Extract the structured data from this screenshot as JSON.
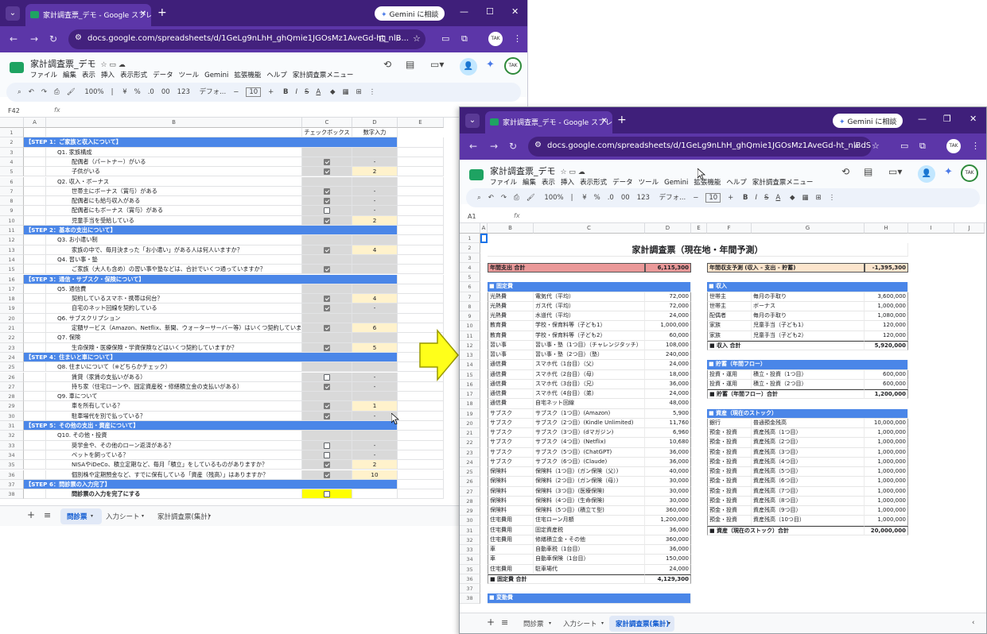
{
  "browser": {
    "tab_title": "家計調査票_デモ - Google スプレ",
    "tab_title_short": "家計調査票_デモ - Google スプレッ",
    "gemini_button": "Gemini に相談",
    "url_short": "docs.google.com/spreadsheets/d/1GeLg9nLhH_ghQmie1JGOsMz1AveGd-ht_nlB...",
    "url_long": "docs.google.com/spreadsheets/d/1GeLg9nLhH_ghQmie1JGOsMz1AveGd-ht_nlBdSvnx...",
    "avatar_text": "TAK"
  },
  "doc": {
    "title": "家計調査票_デモ",
    "menus": [
      "ファイル",
      "編集",
      "表示",
      "挿入",
      "表示形式",
      "データ",
      "ツール",
      "Gemini",
      "拡張機能",
      "ヘルプ",
      "家計調査票メニュー"
    ],
    "toolbar": [
      "100%",
      "¥",
      "%",
      ".0",
      "00",
      "123",
      "デフォ...",
      "10",
      "B",
      "I",
      "S",
      "A"
    ]
  },
  "left": {
    "cell_ref": "F42",
    "columns": [
      "A",
      "B",
      "C",
      "D",
      "E"
    ],
    "header_c": "チェックボックス",
    "header_d": "数字入力",
    "rows": [
      {
        "n": "2",
        "type": "step",
        "text": "【STEP 1：ご家族と収入について】"
      },
      {
        "n": "3",
        "type": "q",
        "text": "Q1. 家族構成"
      },
      {
        "n": "4",
        "type": "item",
        "text": "配偶者（パートナー）がいる",
        "cb": true,
        "d": "-"
      },
      {
        "n": "5",
        "type": "item",
        "text": "子供がいる",
        "cb": true,
        "d": "2",
        "y": true
      },
      {
        "n": "6",
        "type": "q",
        "text": "Q2. 収入・ボーナス"
      },
      {
        "n": "7",
        "type": "item",
        "text": "世帯主にボーナス（賞与）がある",
        "cb": true,
        "d": "-"
      },
      {
        "n": "8",
        "type": "item",
        "text": "配偶者にも給与収入がある",
        "cb": true,
        "d": "-"
      },
      {
        "n": "9",
        "type": "item",
        "text": "配偶者にもボーナス（賞与）がある",
        "cb": false,
        "d": "-"
      },
      {
        "n": "10",
        "type": "item",
        "text": "児童手当を受給している",
        "cb": true,
        "d": "2",
        "y": true
      },
      {
        "n": "11",
        "type": "step",
        "text": "【STEP 2：基本の支出について】"
      },
      {
        "n": "12",
        "type": "q",
        "text": "Q3. お小遣い制"
      },
      {
        "n": "13",
        "type": "item",
        "text": "家族の中で、毎月決まった「お小遣い」がある人は何人いますか？",
        "cb": true,
        "d": "4",
        "y": true
      },
      {
        "n": "14",
        "type": "q",
        "text": "Q4. 習い事・塾"
      },
      {
        "n": "15",
        "type": "item",
        "text": "ご家族（大人も含め）の習い事や塾などは、合計でいくつ通っていますか？",
        "cb": true,
        "d": ""
      },
      {
        "n": "16",
        "type": "step",
        "text": "【STEP 3：通信・サブスク・保険について】"
      },
      {
        "n": "17",
        "type": "q",
        "text": "Q5. 通信費"
      },
      {
        "n": "18",
        "type": "item",
        "text": "契約しているスマホ・携帯は何台？",
        "cb": true,
        "d": "4",
        "y": true
      },
      {
        "n": "19",
        "type": "item",
        "text": "自宅のネット回線を契約している",
        "cb": true,
        "d": "-"
      },
      {
        "n": "20",
        "type": "q",
        "text": "Q6. サブスクリプション"
      },
      {
        "n": "21",
        "type": "item",
        "text": "定額サービス（Amazon、Netflix、新聞、ウォーターサーバー等）はいくつ契約していますか？",
        "cb": true,
        "d": "6",
        "y": true
      },
      {
        "n": "22",
        "type": "q",
        "text": "Q7. 保険"
      },
      {
        "n": "23",
        "type": "item",
        "text": "生命保険・医療保険・学資保険などはいくつ契約していますか？",
        "cb": true,
        "d": "5",
        "y": true
      },
      {
        "n": "24",
        "type": "step",
        "text": "【STEP 4：住まいと車について】"
      },
      {
        "n": "25",
        "type": "q",
        "text": "Q8. 住まいについて（※どちらかチェック）"
      },
      {
        "n": "26",
        "type": "item",
        "text": "賃貸（家賃の支払いがある）",
        "cb": false,
        "d": "-"
      },
      {
        "n": "27",
        "type": "item",
        "text": "持ち家（住宅ローンや、固定資産税・修繕積立金の支払いがある）",
        "cb": true,
        "d": "-"
      },
      {
        "n": "28",
        "type": "q",
        "text": "Q9. 車について"
      },
      {
        "n": "29",
        "type": "item",
        "text": "車を所有している？",
        "cb": true,
        "d": "1",
        "y": true
      },
      {
        "n": "30",
        "type": "item",
        "text": "駐車場代を別で払っている？",
        "cb": true,
        "d": "-"
      },
      {
        "n": "31",
        "type": "step",
        "text": "【STEP 5：その他の支出・資産について】"
      },
      {
        "n": "32",
        "type": "q",
        "text": "Q10. その他・投資"
      },
      {
        "n": "33",
        "type": "item",
        "text": "奨学金や、その他のローン返済がある？",
        "cb": false,
        "d": "-"
      },
      {
        "n": "34",
        "type": "item",
        "text": "ペットを飼っている？",
        "cb": false,
        "d": "-"
      },
      {
        "n": "35",
        "type": "item",
        "text": "NISAやiDeCo、積立定期など、毎月「積立」をしているものがありますか？",
        "cb": true,
        "d": "2",
        "y": true
      },
      {
        "n": "36",
        "type": "item",
        "text": "個別株や定期預金など、すでに保有している「資産（残高）」はありますか？",
        "cb": true,
        "d": "10",
        "y": true
      },
      {
        "n": "37",
        "type": "step",
        "text": "【STEP 6：問診票の入力完了】"
      },
      {
        "n": "38",
        "type": "final",
        "text": "問診票の入力を完了にする",
        "cb": false,
        "d": ""
      }
    ],
    "sheets": [
      "問診票",
      "入力シート",
      "家計調査票(集計)"
    ],
    "active_sheet": 0
  },
  "right": {
    "cell_ref": "A1",
    "columns": [
      "A",
      "B",
      "C",
      "D",
      "E",
      "F",
      "G",
      "H",
      "I",
      "J"
    ],
    "title": "家計調査票（現在地・年間予測）",
    "annual_expense_label": "年間支出 合計",
    "annual_expense_value": "6,115,300",
    "annual_balance_label": "年間収支予測 (収入 - 支出 - 貯蓄)",
    "annual_balance_value": "-1,395,300",
    "fixed_header": "■ 固定費",
    "fixed": [
      [
        "光熱費",
        "電気代（平均）",
        "72,000"
      ],
      [
        "光熱費",
        "ガス代（平均）",
        "72,000"
      ],
      [
        "光熱費",
        "水道代（平均）",
        "24,000"
      ],
      [
        "教育費",
        "学校・保育料等（子ども1）",
        "1,000,000"
      ],
      [
        "教育費",
        "学校・保育料等（子ども2）",
        "60,000"
      ],
      [
        "習い事",
        "習い事・塾（1つ目）（チャレンジタッチ）",
        "108,000"
      ],
      [
        "習い事",
        "習い事・塾（2つ目）（塾）",
        "240,000"
      ],
      [
        "通信費",
        "スマホ代（1台目）（父）",
        "24,000"
      ],
      [
        "通信費",
        "スマホ代（2台目）（母）",
        "18,000"
      ],
      [
        "通信費",
        "スマホ代（3台目）（兄）",
        "36,000"
      ],
      [
        "通信費",
        "スマホ代（4台目）（弟）",
        "24,000"
      ],
      [
        "通信費",
        "自宅ネット回線",
        "48,000"
      ],
      [
        "サブスク",
        "サブスク（1つ目）(Amazon)",
        "5,900"
      ],
      [
        "サブスク",
        "サブスク（2つ目）(Kindle Unlimited)",
        "11,760"
      ],
      [
        "サブスク",
        "サブスク（3つ目）(dマガジン)",
        "6,960"
      ],
      [
        "サブスク",
        "サブスク（4つ目）(Netflix)",
        "10,680"
      ],
      [
        "サブスク",
        "サブスク（5つ目）(ChatGPT)",
        "36,000"
      ],
      [
        "サブスク",
        "サブスク（6つ目）(Claude)",
        "36,000"
      ],
      [
        "保険料",
        "保険料（1つ目）(ガン保険（父）)",
        "40,000"
      ],
      [
        "保険料",
        "保険料（2つ目）(ガン保険（母）)",
        "30,000"
      ],
      [
        "保険料",
        "保険料（3つ目）(医療保険)",
        "30,000"
      ],
      [
        "保険料",
        "保険料（4つ目）(生命保険)",
        "30,000"
      ],
      [
        "保険料",
        "保険料（5つ目）(積立て型)",
        "360,000"
      ],
      [
        "住宅費用",
        "住宅ローン月額",
        "1,200,000"
      ],
      [
        "住宅費用",
        "固定資産税",
        "36,000"
      ],
      [
        "住宅費用",
        "修繕積立金・その他",
        "360,000"
      ],
      [
        "車",
        "自動車税（1台目）",
        "36,000"
      ],
      [
        "車",
        "自動車保険（1台目）",
        "150,000"
      ],
      [
        "住宅費用",
        "駐車場代",
        "24,000"
      ]
    ],
    "fixed_total_label": "■ 固定費 合計",
    "fixed_total_value": "4,129,300",
    "variable_header": "■ 変動費",
    "income_header": "■ 収入",
    "income": [
      [
        "世帯主",
        "毎月の手取り",
        "3,600,000"
      ],
      [
        "世帯主",
        "ボーナス",
        "1,000,000"
      ],
      [
        "配偶者",
        "毎月の手取り",
        "1,080,000"
      ],
      [
        "家族",
        "児童手当（子ども1）",
        "120,000"
      ],
      [
        "家族",
        "児童手当（子ども2）",
        "120,000"
      ]
    ],
    "income_total_label": "■ 収入 合計",
    "income_total_value": "5,920,000",
    "savings_header": "■ 貯蓄（年間フロー）",
    "savings": [
      [
        "投資・運用",
        "積立・投資（1つ目）",
        "600,000"
      ],
      [
        "投資・運用",
        "積立・投資（2つ目）",
        "600,000"
      ]
    ],
    "savings_total_label": "■ 貯蓄（年間フロー）合計",
    "savings_total_value": "1,200,000",
    "assets_header": "■ 資産（現在のストック）",
    "assets": [
      [
        "銀行",
        "普通預金残高",
        "10,000,000"
      ],
      [
        "預金・投資",
        "資産残高（1つ目）",
        "1,000,000"
      ],
      [
        "預金・投資",
        "資産残高（2つ目）",
        "1,000,000"
      ],
      [
        "預金・投資",
        "資産残高（3つ目）",
        "1,000,000"
      ],
      [
        "預金・投資",
        "資産残高（4つ目）",
        "1,000,000"
      ],
      [
        "預金・投資",
        "資産残高（5つ目）",
        "1,000,000"
      ],
      [
        "預金・投資",
        "資産残高（6つ目）",
        "1,000,000"
      ],
      [
        "預金・投資",
        "資産残高（7つ目）",
        "1,000,000"
      ],
      [
        "預金・投資",
        "資産残高（8つ目）",
        "1,000,000"
      ],
      [
        "預金・投資",
        "資産残高（9つ目）",
        "1,000,000"
      ],
      [
        "預金・投資",
        "資産残高（10つ目）",
        "1,000,000"
      ]
    ],
    "assets_total_label": "■ 資産（現在のストック）合計",
    "assets_total_value": "20,000,000",
    "sheets": [
      "問診票",
      "入力シート",
      "家計調査票(集計)"
    ],
    "active_sheet": 2
  },
  "colors": {
    "step_blue": "#4a86e8",
    "tab_purple": "#5c36a8",
    "frame_purple": "#3f1f7a",
    "arrow_yellow": "#ffff1a",
    "pink": "#ea9999",
    "orange_light": "#fce5cd"
  }
}
